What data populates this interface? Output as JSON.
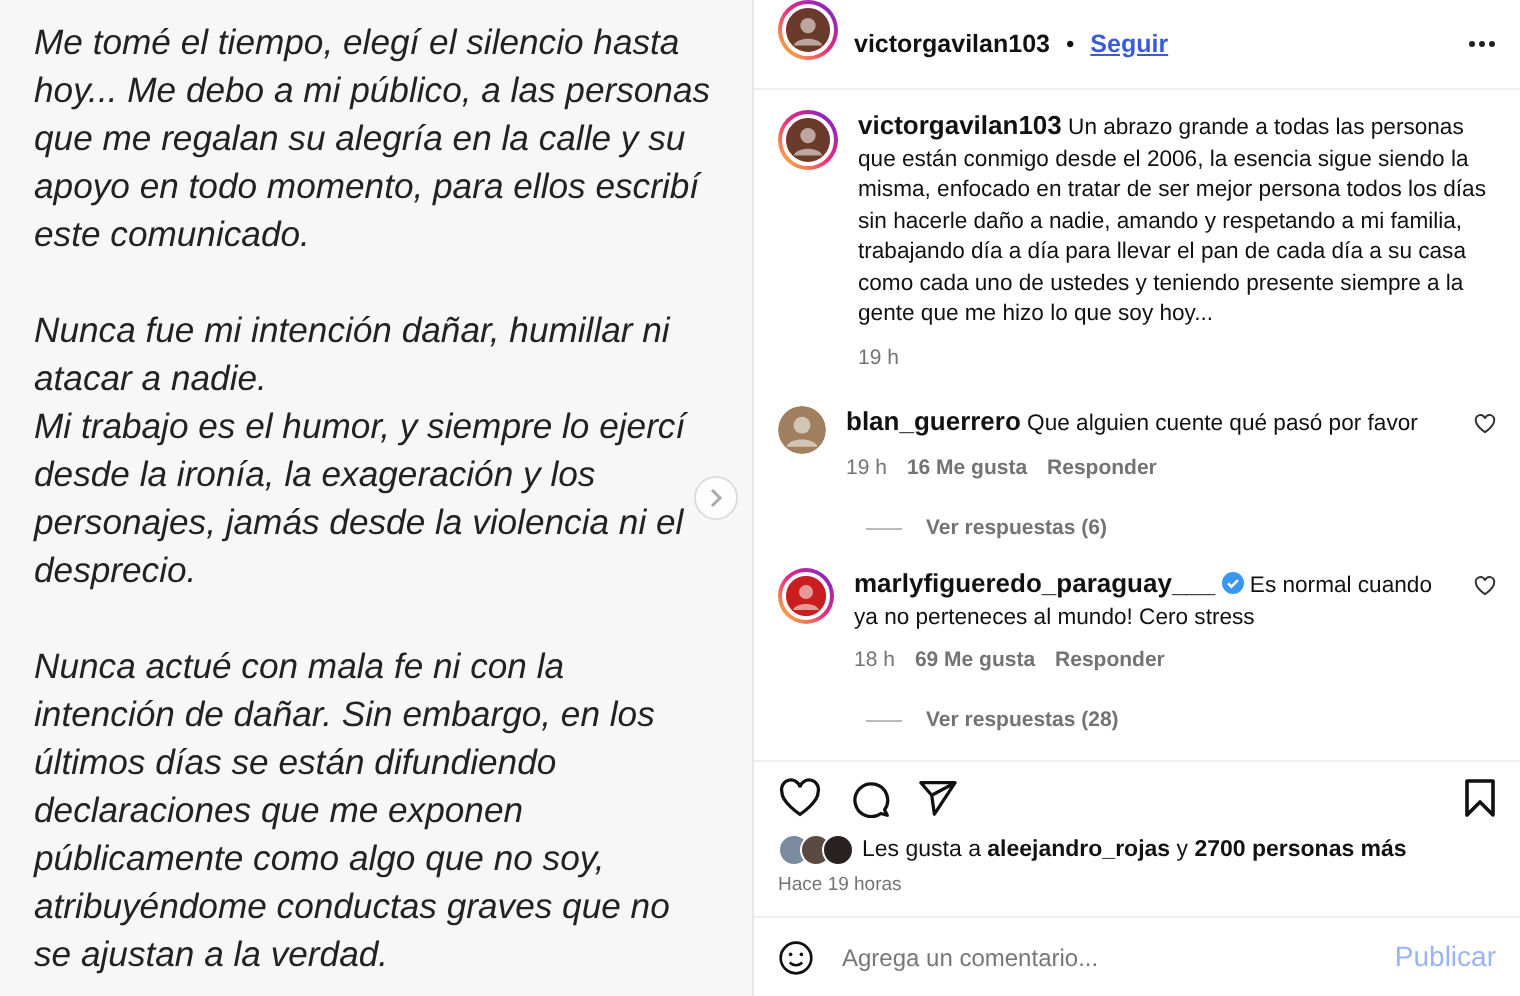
{
  "post_image": {
    "kind": "text",
    "sections": [
      {
        "paragraphs": [
          {
            "lines": [
              "Me tomé el tiempo, elegí el silencio hasta",
              "hoy... Me debo a mi público, a las personas",
              "que me regalan su alegría en la calle y su",
              "apoyo en todo momento, para ellos escribí",
              "este comunicado."
            ]
          }
        ]
      },
      {
        "paragraphs": [
          {
            "lines": [
              "Nunca fue mi intención dañar, humillar ni",
              "atacar a nadie."
            ]
          },
          {
            "lines": [
              "Mi trabajo es el humor, y siempre lo ejercí",
              "desde la ironía, la exageración y los",
              "personajes, jamás desde la violencia ni el",
              "desprecio."
            ]
          }
        ]
      },
      {
        "paragraphs": [
          {
            "lines": [
              "Nunca actué con mala fe ni con la",
              "intención de dañar. Sin embargo, en los",
              "últimos días se están difundiendo",
              "declaraciones que me exponen",
              "públicamente como algo que no soy,",
              "atribuyéndome conductas graves que no",
              "se ajustan a la verdad."
            ]
          }
        ]
      }
    ]
  },
  "header": {
    "username": "victorgavilan103",
    "separator": "•",
    "follow": "Seguir"
  },
  "caption": {
    "username": "victorgavilan103",
    "text": "Un abrazo grande a todas las personas que están conmigo desde el 2006, la esencia sigue siendo la misma, enfocado en tratar de ser mejor persona todos los días sin hacerle daño a nadie, amando y respetando a mi familia, trabajando día a día para llevar el pan de cada día a su casa como cada uno de ustedes y teniendo presente siempre a la gente que me hizo lo que soy hoy...",
    "time": "19 h"
  },
  "comments": [
    {
      "username": "blan_guerrero",
      "story": false,
      "verified": false,
      "text": "Que alguien cuente qué pasó por favor",
      "time": "19 h",
      "likes": "16 Me gusta",
      "reply": "Responder",
      "view_replies": "Ver respuestas (6)",
      "color": "#a08060"
    },
    {
      "username": "marlyfigueredo_paraguay___",
      "story": true,
      "verified": true,
      "text": "Es normal cuando ya no perteneces al mundo! Cero stress",
      "time": "18 h",
      "likes": "69 Me gusta",
      "reply": "Responder",
      "view_replies": "Ver respuestas (28)",
      "color": "#c81e1e"
    }
  ],
  "likes": {
    "prefix": "Les gusta a ",
    "user": "aleejandro_rojas",
    "suffix": " y ",
    "count": "2700 personas más"
  },
  "date": "Hace 19 horas",
  "comment_box": {
    "placeholder": "Agrega un comentario...",
    "submit": "Publicar"
  }
}
